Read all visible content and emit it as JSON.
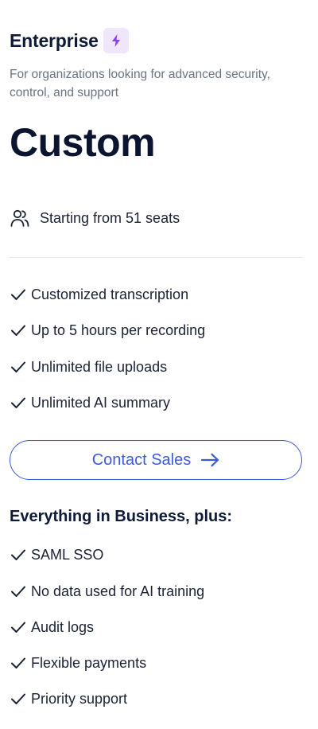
{
  "plan": {
    "name": "Enterprise",
    "description": "For organizations looking for advanced security, control, and support",
    "price": "Custom",
    "seats": "Starting from 51 seats",
    "badge_icon": "lightning-bolt-icon",
    "seats_icon": "users-icon"
  },
  "features": [
    "Customized transcription",
    "Up to 5 hours per recording",
    "Unlimited file uploads",
    "Unlimited AI summary"
  ],
  "cta": {
    "label": "Contact Sales",
    "icon": "arrow-right-icon"
  },
  "extras": {
    "heading": "Everything in Business, plus:",
    "items": [
      "SAML SSO",
      "No data used for AI training",
      "Audit logs",
      "Flexible payments",
      "Priority support"
    ]
  },
  "colors": {
    "accent": "#3b5bdb",
    "badge_bg": "#efe6fb",
    "badge_icon": "#8b3df0",
    "text_primary": "#0f1a36",
    "text_muted": "#6b7280",
    "divider": "#e5e7eb"
  }
}
